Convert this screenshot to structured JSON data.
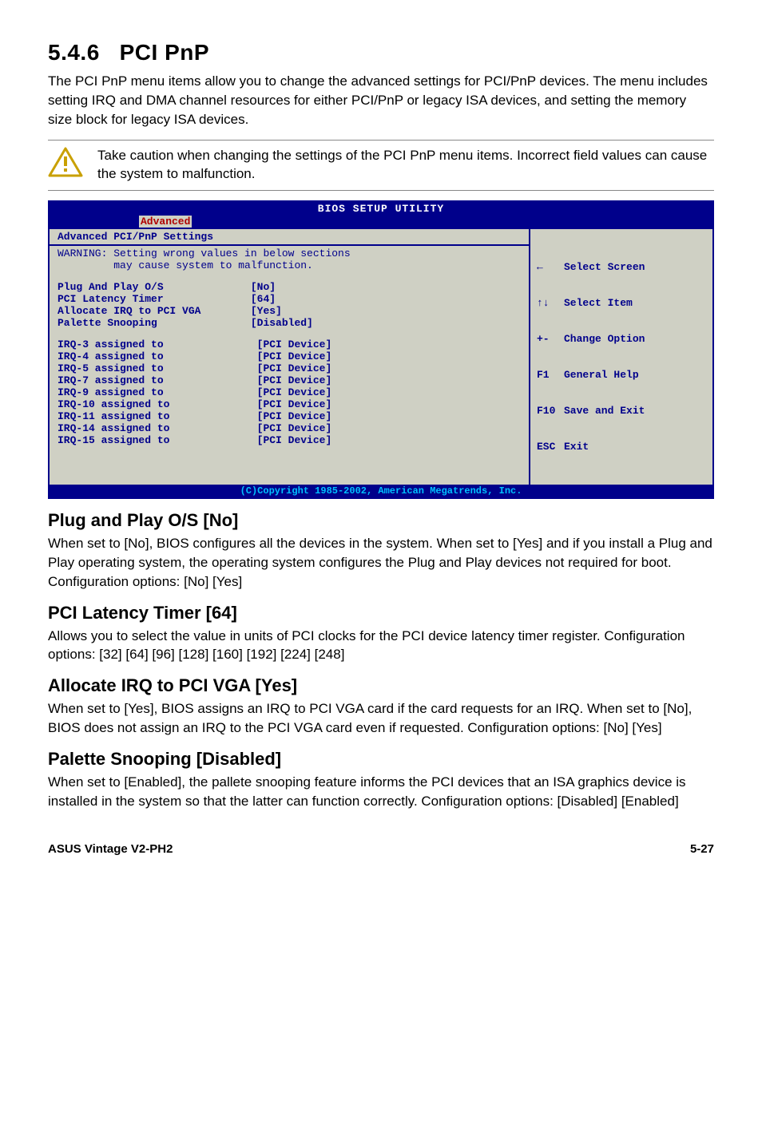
{
  "section": {
    "number": "5.4.6",
    "title": "PCI PnP",
    "intro": "The PCI PnP menu items allow you to change the advanced settings for PCI/PnP devices. The menu includes setting IRQ and DMA channel resources for either PCI/PnP or legacy ISA devices, and setting the memory size block for legacy ISA devices."
  },
  "caution": "Take caution when changing the settings of the PCI PnP menu items. Incorrect field values can cause the system to malfunction.",
  "bios": {
    "title": "BIOS SETUP UTILITY",
    "tab": "Advanced",
    "panel_heading": "Advanced PCI/PnP Settings",
    "warning": "WARNING: Setting wrong values in below sections\n         may cause system to malfunction.",
    "settings_block": "Plug And Play O/S              [No]\nPCI Latency Timer              [64]\nAllocate IRQ to PCI VGA        [Yes]\nPalette Snooping               [Disabled]",
    "irq_block": "IRQ-3 assigned to               [PCI Device]\nIRQ-4 assigned to               [PCI Device]\nIRQ-5 assigned to               [PCI Device]\nIRQ-7 assigned to               [PCI Device]\nIRQ-9 assigned to               [PCI Device]\nIRQ-10 assigned to              [PCI Device]\nIRQ-11 assigned to              [PCI Device]\nIRQ-14 assigned to              [PCI Device]\nIRQ-15 assigned to              [PCI Device]",
    "nav": {
      "select_screen": "Select Screen",
      "select_item": "Select Item",
      "change_option": "Change Option",
      "general_help": "General Help",
      "save_exit": "Save and Exit",
      "exit": "Exit",
      "keys": {
        "lr": "←",
        "ud": "↑↓",
        "pm": "+-",
        "f1": "F1",
        "f10": "F10",
        "esc": "ESC"
      }
    },
    "copyright": "(C)Copyright 1985-2002, American Megatrends, Inc."
  },
  "subs": {
    "plug_title": "Plug and Play O/S [No]",
    "plug_body": "When set to [No], BIOS configures all the devices in the system. When set to [Yes] and if you install a Plug and Play operating system, the operating system configures the Plug and Play devices not required for boot. Configuration options: [No] [Yes]",
    "lat_title": "PCI Latency Timer [64]",
    "lat_body": "Allows you to select the value in units of PCI clocks for the PCI device latency timer register. Configuration options: [32] [64] [96] [128] [160] [192] [224] [248]",
    "alloc_title": "Allocate IRQ to PCI VGA [Yes]",
    "alloc_body": "When set to [Yes], BIOS assigns an IRQ to PCI VGA card if the card requests for an IRQ. When set to [No], BIOS does not assign an IRQ to the PCI VGA card even if requested. Configuration options: [No] [Yes]",
    "pal_title": "Palette Snooping [Disabled]",
    "pal_body": "When set to [Enabled], the pallete snooping feature informs the PCI devices that an ISA graphics device is installed in the system so that the latter can function correctly. Configuration options: [Disabled] [Enabled]"
  },
  "footer": {
    "left": "ASUS Vintage V2-PH2",
    "right": "5-27"
  }
}
